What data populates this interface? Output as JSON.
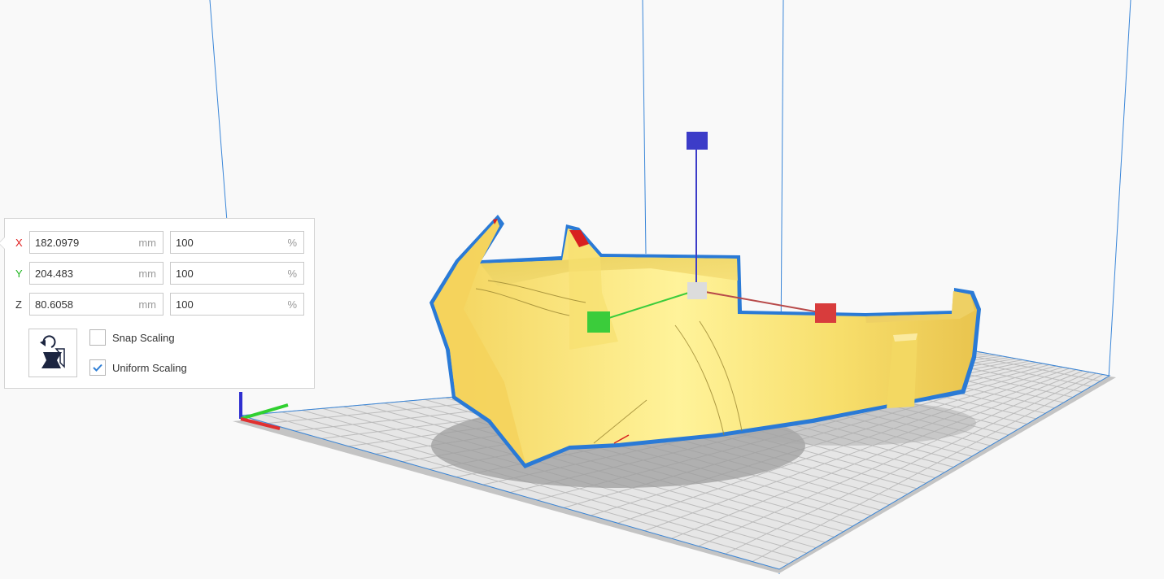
{
  "scale_tool": {
    "rows": [
      {
        "axis": "X",
        "axis_color": "#e02020",
        "mm_value": "182.0979",
        "mm_unit": "mm",
        "percent_value": "100",
        "percent_unit": "%"
      },
      {
        "axis": "Y",
        "axis_color": "#1fb51f",
        "mm_value": "204.483",
        "mm_unit": "mm",
        "percent_value": "100",
        "percent_unit": "%"
      },
      {
        "axis": "Z",
        "axis_color": "#333333",
        "mm_value": "80.6058",
        "mm_unit": "mm",
        "percent_value": "100",
        "percent_unit": "%"
      }
    ],
    "snap_scaling_label": "Snap Scaling",
    "snap_scaling_checked": false,
    "uniform_scaling_label": "Uniform Scaling",
    "uniform_scaling_checked": true
  },
  "viewport": {
    "model_color": "#fbe77a",
    "outline_color": "#2a7ad6",
    "handle_colors": {
      "x": "#d83c3c",
      "y": "#3bcc3b",
      "z": "#3c3cc8",
      "center": "#dcdcdc"
    }
  }
}
